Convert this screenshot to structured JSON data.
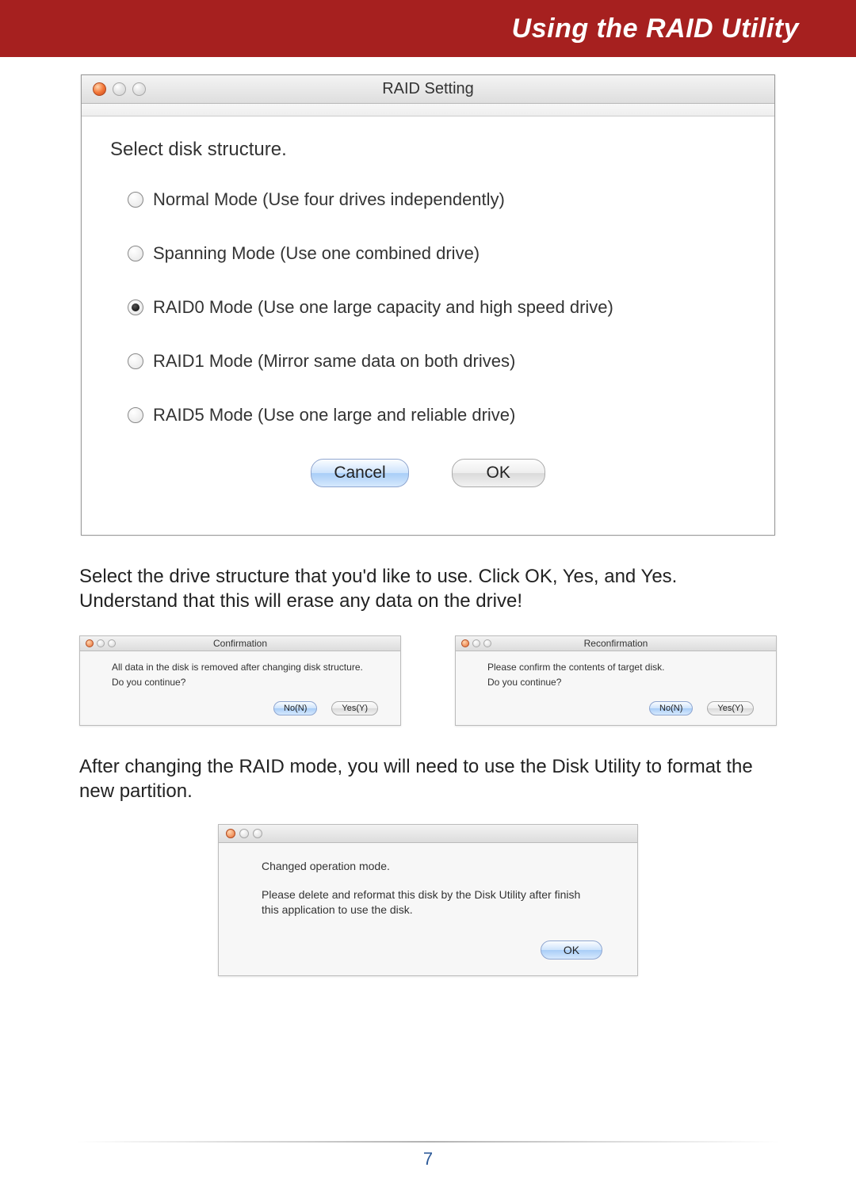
{
  "header": {
    "title": "Using the RAID Utility"
  },
  "mainWindow": {
    "title": "RAID Setting",
    "instruction": "Select disk structure.",
    "options": [
      {
        "label": "Normal Mode (Use four drives independently)",
        "selected": false
      },
      {
        "label": "Spanning Mode (Use one combined drive)",
        "selected": false
      },
      {
        "label": "RAID0 Mode (Use one large capacity and high speed drive)",
        "selected": true
      },
      {
        "label": "RAID1 Mode (Mirror same data on both drives)",
        "selected": false
      },
      {
        "label": "RAID5 Mode (Use one large and reliable drive)",
        "selected": false
      }
    ],
    "buttons": {
      "cancel": "Cancel",
      "ok": "OK"
    }
  },
  "para1": "Select the drive structure that you'd like to use.  Click OK, Yes, and Yes.  Understand that this will erase any data on the drive!",
  "confirmDialog": {
    "title": "Confirmation",
    "line1": "All data in the disk is removed after changing disk structure.",
    "line2": "Do you continue?",
    "no": "No(N)",
    "yes": "Yes(Y)"
  },
  "reconfirmDialog": {
    "title": "Reconfirmation",
    "line1": "Please confirm the contents of target disk.",
    "line2": "Do you continue?",
    "no": "No(N)",
    "yes": "Yes(Y)"
  },
  "para2": "After changing the RAID mode, you will need to use the Disk Utility to format the new partition.",
  "finalDialog": {
    "line1": "Changed operation mode.",
    "line2": "Please delete and reformat this disk by the Disk Utility after finish this application to use the disk.",
    "ok": "OK"
  },
  "pageNumber": "7"
}
